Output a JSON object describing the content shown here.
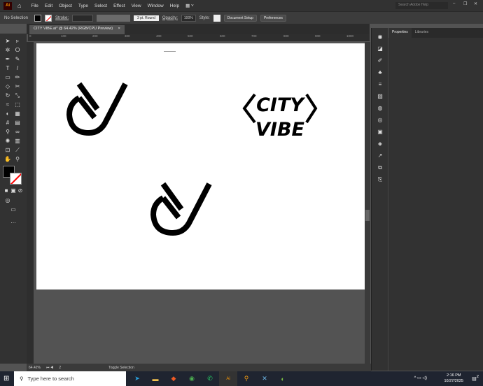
{
  "app": {
    "logo": "Ai",
    "menus": [
      "File",
      "Edit",
      "Object",
      "Type",
      "Select",
      "Effect",
      "View",
      "Window",
      "Help"
    ],
    "search_placeholder": "Search Adobe Help"
  },
  "control": {
    "selection": "No Selection",
    "stroke_label": "Stroke:",
    "brush": "3 pt. Round",
    "opacity_label": "Opacity:",
    "opacity": "100%",
    "style_label": "Style:",
    "document_setup": "Document Setup",
    "preferences": "Preferences"
  },
  "document": {
    "tab_title": "CITY VIBE.ai* @ 64.42% (RGB/CPU Preview)",
    "close": "×"
  },
  "ruler": {
    "ticks": [
      "0",
      "100",
      "200",
      "300",
      "400",
      "500",
      "600",
      "700",
      "800",
      "900",
      "1000"
    ]
  },
  "artboard": {
    "logo_text_line1": "CITY",
    "logo_text_line2": "VIBE"
  },
  "panel": {
    "tabs": [
      "Properties",
      "Libraries"
    ]
  },
  "status": {
    "zoom": "64.42%",
    "artboard": "2",
    "tool": "Toggle Selection"
  },
  "taskbar": {
    "search_placeholder": "Type here to search",
    "time": "2:16 PM",
    "date": "10/27/2025",
    "notifications": "2",
    "apps": [
      "telegram",
      "file-explorer",
      "brave",
      "chrome",
      "whatsapp",
      "illustrator",
      "search-app",
      "x-app",
      "edge-app"
    ]
  },
  "colors": {
    "fill": "#000000",
    "accent_ai": "#ff9a00"
  }
}
